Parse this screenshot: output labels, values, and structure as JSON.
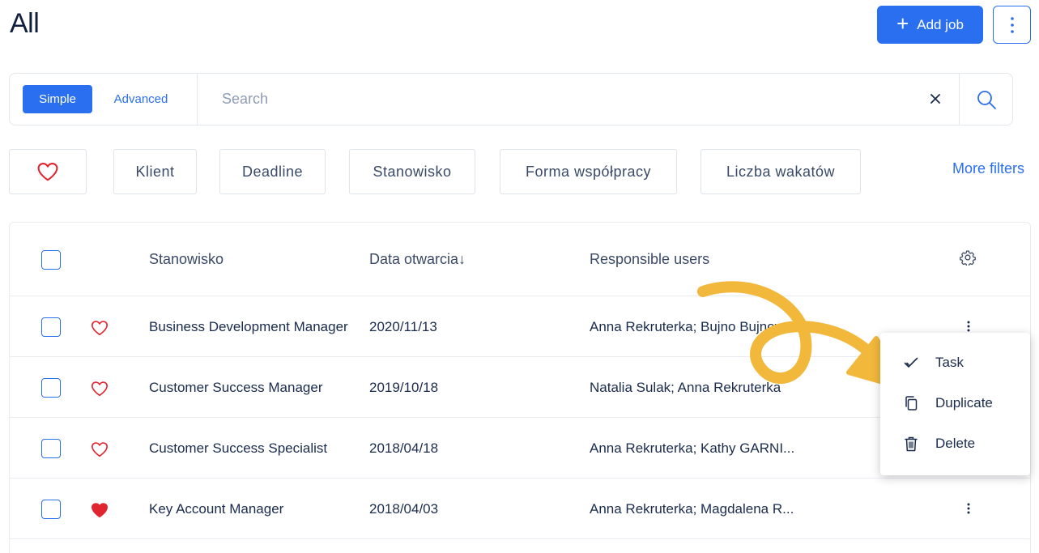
{
  "page": {
    "title": "All"
  },
  "header": {
    "add_job_label": "Add job",
    "add_job_icon": "plus-icon",
    "more_icon": "vertical-dots-icon",
    "accent_color": "#2a6ff0"
  },
  "search": {
    "modes": [
      "Simple",
      "Advanced"
    ],
    "active_mode": "Simple",
    "placeholder": "Search",
    "value": "",
    "clear_icon": "close-icon",
    "search_icon": "search-icon"
  },
  "filters": {
    "favorite_icon": "heart-outline-icon",
    "chips": [
      "Klient",
      "Deadline",
      "Stanowisko",
      "Forma współpracy",
      "Liczba wakatów"
    ],
    "more_label": "More filters"
  },
  "table": {
    "columns": {
      "position": "Stanowisko",
      "open_date": "Data otwarcia",
      "open_date_sort": "↓",
      "responsible": "Responsible users",
      "settings_icon": "gear-icon"
    },
    "rows": [
      {
        "favorite": false,
        "position": "Business Development Manager",
        "open_date": "2020/11/13",
        "responsible": "Anna Rekruterka; Bujno Bujnow"
      },
      {
        "favorite": false,
        "position": "Customer Success Manager",
        "open_date": "2019/10/18",
        "responsible": "Natalia Sulak; Anna Rekruterka"
      },
      {
        "favorite": false,
        "position": "Customer Success Specialist",
        "open_date": "2018/04/18",
        "responsible": "Anna Rekruterka; Kathy GARNI..."
      },
      {
        "favorite": true,
        "position": "Key Account Manager",
        "open_date": "2018/04/03",
        "responsible": "Anna Rekruterka; Magdalena R..."
      }
    ],
    "heart_color": "#e0252f"
  },
  "context_menu": {
    "items": [
      {
        "label": "Task",
        "icon": "checkmark-icon"
      },
      {
        "label": "Duplicate",
        "icon": "copy-icon"
      },
      {
        "label": "Delete",
        "icon": "trash-icon"
      }
    ]
  },
  "annotation": {
    "color": "#f2b83b"
  }
}
